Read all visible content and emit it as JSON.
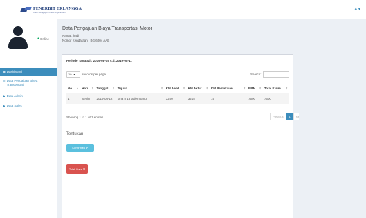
{
  "header": {
    "logo_name": "PENERBIT ERLANGGA",
    "logo_tagline": "Kami Mengayun Ilmu Pengetahuan",
    "user_icon": "user-icon",
    "user_caret": "▾"
  },
  "sidebar": {
    "status": "Online",
    "items": [
      {
        "label": "Dashboard",
        "icon": "dashboard-icon"
      },
      {
        "label": "Data Pengajuan Biaya Transportasi",
        "icon": "list-icon"
      },
      {
        "label": "Data Admin",
        "icon": "users-icon"
      },
      {
        "label": "Data Sales",
        "icon": "users-icon"
      }
    ]
  },
  "page": {
    "title": "Data Pengajuan Biaya Transportasi Motor",
    "nama": "Nama : hadi",
    "nomor": "Nomor Kendaraan : BG 6004 AAE"
  },
  "box": {
    "periode": "Periode Tanggal : 2019-08-05 s.d. 2019-08-11",
    "length_value": "10",
    "length_suffix": "records per page",
    "search_label": "Search:",
    "search_value": ""
  },
  "table": {
    "headers": [
      "No.",
      "Hari",
      "Tanggal",
      "Tujuan",
      "KM Awal",
      "KM Akhir",
      "KM Pemakaian",
      "BBM",
      "Total Klaim"
    ],
    "rows": [
      [
        "1",
        "Senin",
        "2019-08-12",
        "sma n 18 palembang",
        "3200",
        "3215",
        "15",
        "7500",
        "7500"
      ]
    ]
  },
  "info": "Showing 1 to 1 of 1 entries",
  "pager": {
    "prev": "Previous",
    "current": "1",
    "next": "Next"
  },
  "tentukan": "Tentukan",
  "buttons": {
    "confirm": "Konfirmasi ✔",
    "reject": "Tolak Data ✖"
  },
  "colors": {
    "primary": "#3c8dbc",
    "info": "#5bc0de",
    "danger": "#d9534f",
    "online": "#00a65a"
  }
}
